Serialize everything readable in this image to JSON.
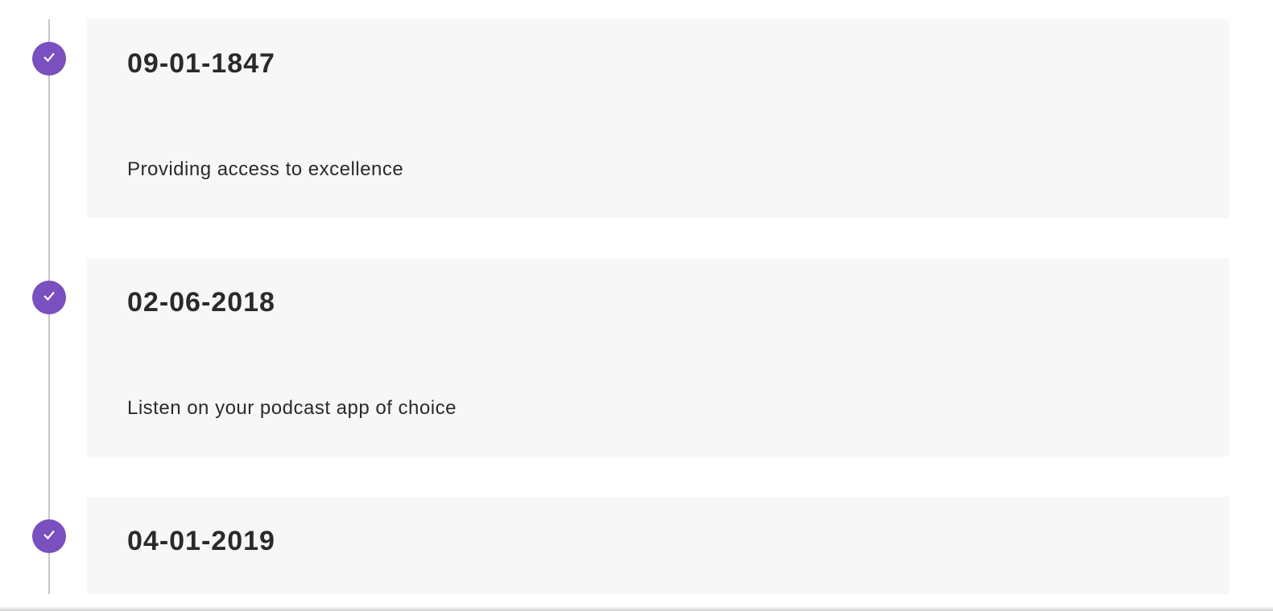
{
  "colors": {
    "marker_bg": "#7a4fbf",
    "card_bg": "#f7f7f7",
    "line": "#c7c7c7"
  },
  "timeline": [
    {
      "date": "09-01-1847",
      "description": "Providing access to excellence"
    },
    {
      "date": "02-06-2018",
      "description": "Listen on your podcast app of choice"
    },
    {
      "date": "04-01-2019",
      "description": ""
    }
  ]
}
